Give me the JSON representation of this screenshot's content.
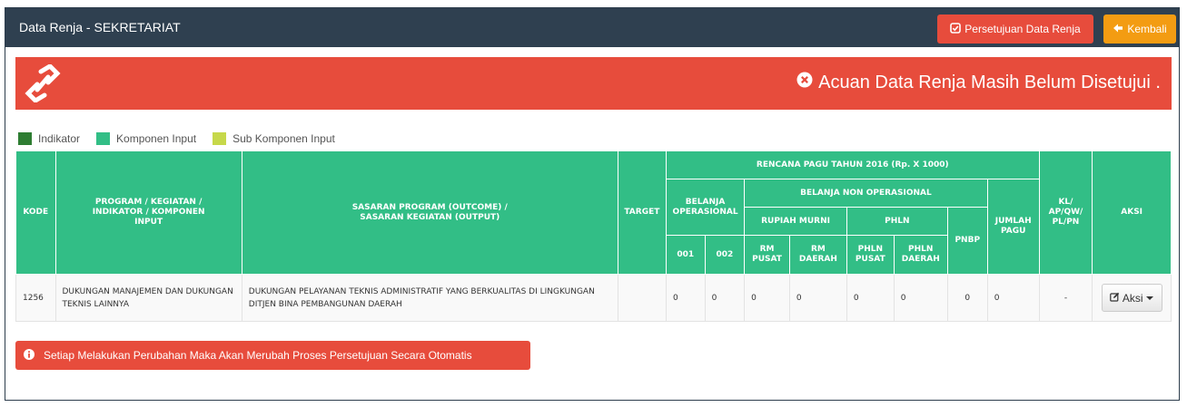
{
  "header": {
    "title": "Data Renja - SEKRETARIAT",
    "approve_label": "Persetujuan Data Renja",
    "back_label": "Kembali"
  },
  "alert": {
    "message": "Acuan Data Renja Masih Belum Disetujui ."
  },
  "legend": [
    {
      "label": "Indikator",
      "color": "#2e7d32"
    },
    {
      "label": "Komponen Input",
      "color": "#32be86"
    },
    {
      "label": "Sub Komponen Input",
      "color": "#c6d84a"
    }
  ],
  "table": {
    "headers": {
      "kode": "KODE",
      "program": "PROGRAM / KEGIATAN / INDIKATOR / KOMPONEN INPUT",
      "sasaran": "SASARAN PROGRAM (OUTCOME) / SASARAN KEGIATAN (OUTPUT)",
      "target": "TARGET",
      "rencana": "RENCANA PAGU TAHUN 2016 (Rp. X 1000)",
      "belanja_op": "BELANJA OPERASIONAL",
      "belanja_non_op": "BELANJA NON OPERASIONAL",
      "rupiah_murni": "RUPIAH MURNI",
      "phln": "PHLN",
      "pnbp": "PNBP",
      "jumlah_pagu": "JUMLAH PAGU",
      "kl": "KL/ AP/QW/ PL/PN",
      "aksi": "AKSI",
      "c001": "001",
      "c002": "002",
      "rm_pusat": "RM PUSAT",
      "rm_daerah": "RM DAERAH",
      "phln_pusat": "PHLN PUSAT",
      "phln_daerah": "PHLN DAERAH"
    },
    "rows": [
      {
        "kode": "1256",
        "program": "DUKUNGAN MANAJEMEN DAN DUKUNGAN TEKNIS LAINNYA",
        "sasaran": "DUKUNGAN PELAYANAN TEKNIS ADMINISTRATIF YANG BERKUALITAS DI LINGKUNGAN DITJEN BINA PEMBANGUNAN DAERAH",
        "target": "",
        "v001": "0",
        "v002": "0",
        "rm_pusat": "0",
        "rm_daerah": "0",
        "phln_pusat": "0",
        "phln_daerah": "0",
        "pnbp": "0",
        "jumlah": "0",
        "kl": "-",
        "aksi_label": "Aksi"
      }
    ]
  },
  "warning": {
    "message": "Setiap Melakukan Perubahan Maka Akan Merubah Proses Persetujuan Secara Otomatis"
  },
  "colors": {
    "header_bg": "#2f4050",
    "danger": "#e74c3c",
    "warning": "#f39c12",
    "table_header": "#32be86"
  },
  "icons": {
    "approve": "check-square-icon",
    "back": "arrow-left-icon",
    "logo": "link-logo-icon",
    "alert": "times-circle-icon",
    "aksi": "edit-icon",
    "warning": "info-circle-icon"
  }
}
